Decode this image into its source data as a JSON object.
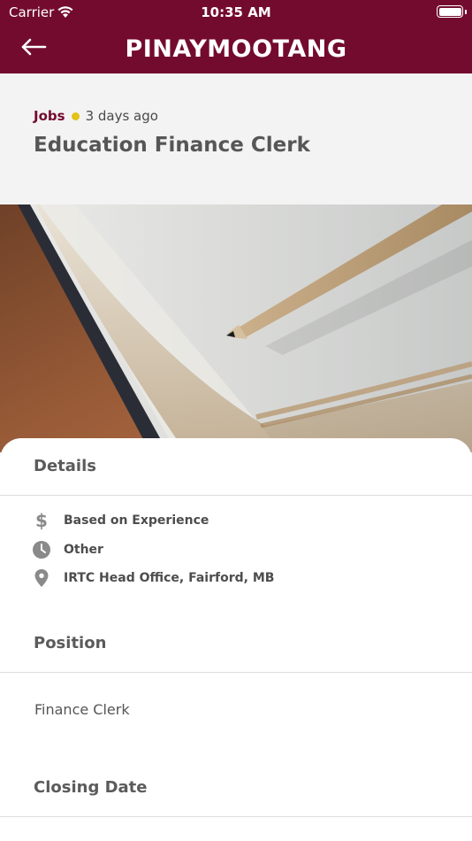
{
  "status_bar": {
    "carrier": "Carrier",
    "time": "10:35 AM"
  },
  "header": {
    "title": "PINAYMOOTANG",
    "back_icon": "arrow-left-icon",
    "background": "#730b2e"
  },
  "post": {
    "category": "Jobs",
    "posted_ago": "3 days ago",
    "title": "Education Finance Clerk",
    "category_color": "#730b2e",
    "dot_color": "#e3c21a"
  },
  "details": {
    "heading": "Details",
    "items": [
      {
        "icon": "dollar-icon",
        "label": "Based on Experience"
      },
      {
        "icon": "clock-icon",
        "label": "Other"
      },
      {
        "icon": "map-pin-icon",
        "label": "IRTC Head Office, Fairford, MB"
      }
    ]
  },
  "position": {
    "heading": "Position",
    "value": "Finance Clerk"
  },
  "closing_date": {
    "heading": "Closing Date"
  }
}
